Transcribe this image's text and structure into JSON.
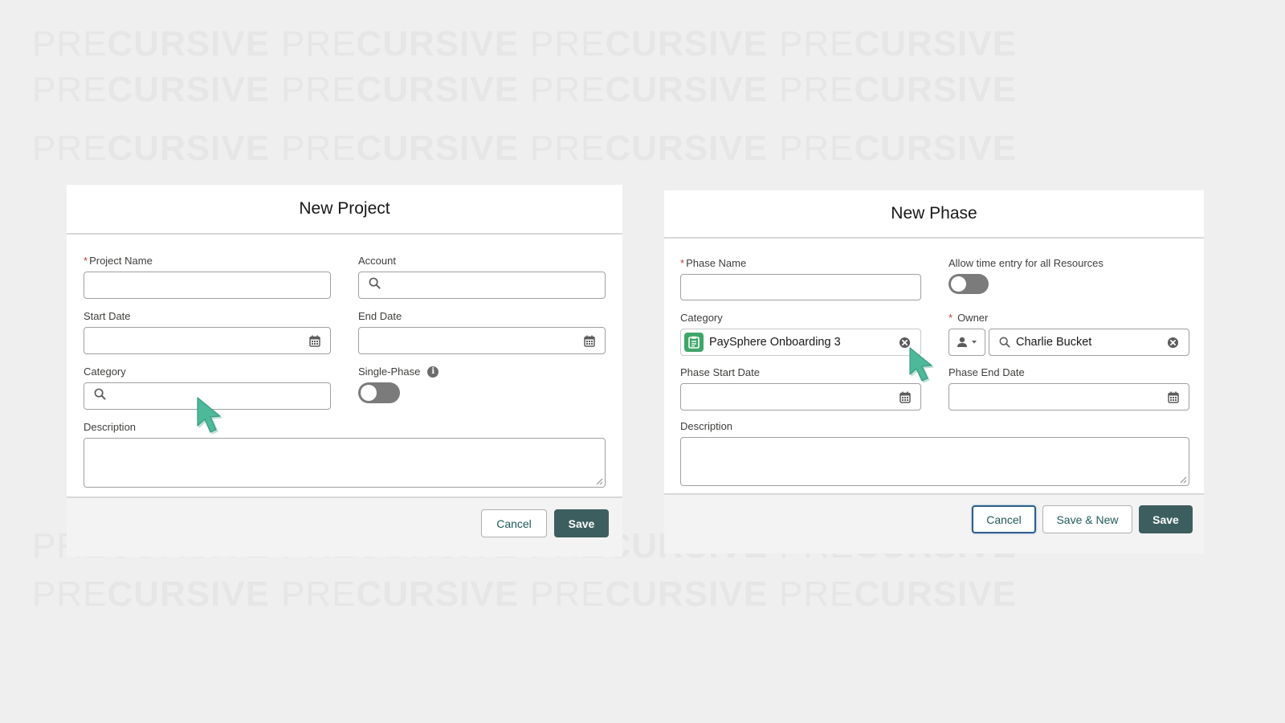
{
  "watermark": {
    "part1": "PRE",
    "part2": "CURSIVE"
  },
  "new_project": {
    "title": "New Project",
    "project_name_label": "Project Name",
    "account_label": "Account",
    "start_date_label": "Start Date",
    "end_date_label": "End Date",
    "category_label": "Category",
    "single_phase_label": "Single-Phase",
    "description_label": "Description",
    "single_phase_on": false,
    "cancel_label": "Cancel",
    "save_label": "Save"
  },
  "new_phase": {
    "title": "New Phase",
    "phase_name_label": "Phase Name",
    "allow_time_entry_label": "Allow time entry for all Resources",
    "allow_time_entry_on": false,
    "category_label": "Category",
    "category_value": "PaySphere Onboarding 3",
    "owner_label": "Owner",
    "owner_value": "Charlie Bucket",
    "phase_start_date_label": "Phase Start Date",
    "phase_end_date_label": "Phase End Date",
    "description_label": "Description",
    "cancel_label": "Cancel",
    "save_new_label": "Save & New",
    "save_label": "Save"
  },
  "colors": {
    "brand": "#3c5e5e",
    "required": "#c23934",
    "category_icon": "#3fa66a",
    "cursor": "#4db89a"
  },
  "icons": [
    "search-icon",
    "calendar-icon",
    "info-icon",
    "clear-icon",
    "user-icon",
    "chevron-down-icon",
    "cursor-icon",
    "category-icon"
  ]
}
